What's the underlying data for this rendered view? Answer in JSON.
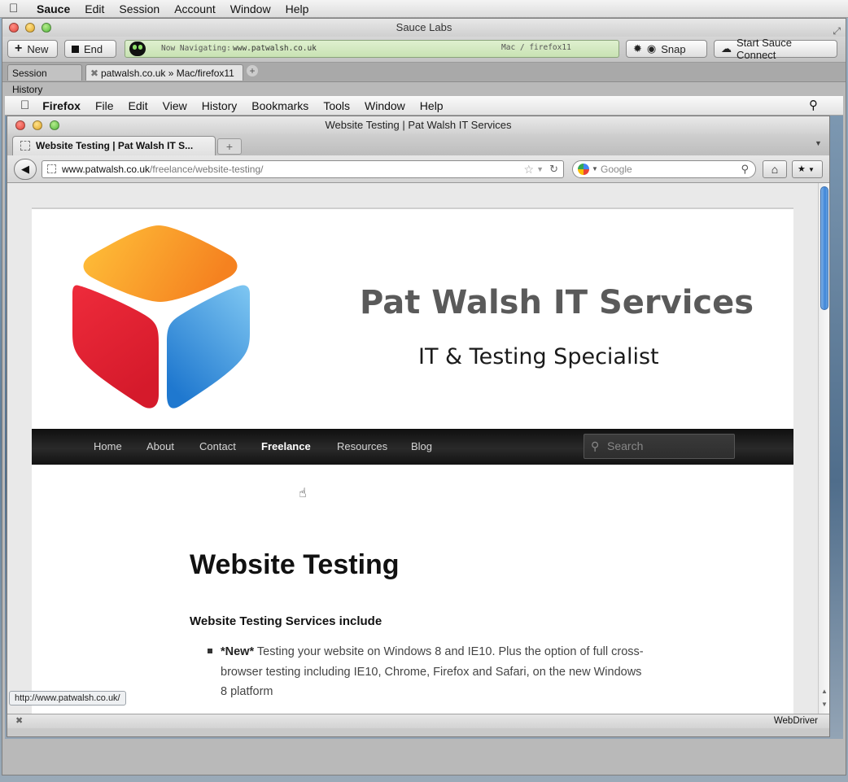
{
  "os_menubar": {
    "app": "Sauce",
    "items": [
      "Edit",
      "Session",
      "Account",
      "Window",
      "Help"
    ]
  },
  "sauce_window": {
    "title": "Sauce Labs",
    "toolbar": {
      "new_label": "New",
      "end_label": "End",
      "navigating_label": "Now Navigating:",
      "navigating_url": "www.patwalsh.co.uk",
      "platform": "Mac / firefox11",
      "snap_label": "Snap",
      "connect_label": "Start Sauce Connect"
    },
    "tabs": {
      "history_label": "Session History",
      "session_label": "patwalsh.co.uk » Mac/firefox11"
    }
  },
  "ff_menubar": {
    "app": "Firefox",
    "items": [
      "File",
      "Edit",
      "View",
      "History",
      "Bookmarks",
      "Tools",
      "Window",
      "Help"
    ]
  },
  "firefox": {
    "window_title": "Website Testing | Pat Walsh IT Services",
    "tab_label": "Website Testing | Pat Walsh IT S...",
    "url_domain": "www.patwalsh.co.uk",
    "url_path": "/freelance/website-testing/",
    "search_placeholder": "Google",
    "status_url": "http://www.patwalsh.co.uk/",
    "addon_label": "WebDriver"
  },
  "site": {
    "title": "Pat Walsh IT Services",
    "tagline": "IT & Testing Specialist",
    "nav": [
      "Home",
      "About",
      "Contact",
      "Freelance",
      "Resources",
      "Blog"
    ],
    "active_nav": "Freelance",
    "search_placeholder": "Search",
    "heading": "Website Testing",
    "section_heading": "Website Testing Services include",
    "item_new": "*New*",
    "item_text": "Testing your website on Windows 8 and IE10. Plus the option of full cross-browser testing including IE10, Chrome, Firefox and Safari, on the new Windows 8 platform"
  },
  "colors": {
    "logo_orange": "#f7941d",
    "logo_red": "#e8202e",
    "logo_blue": "#2b87d6",
    "nav_bg": "#1a1a1a",
    "navigating_bg": "#cfe6bb"
  }
}
